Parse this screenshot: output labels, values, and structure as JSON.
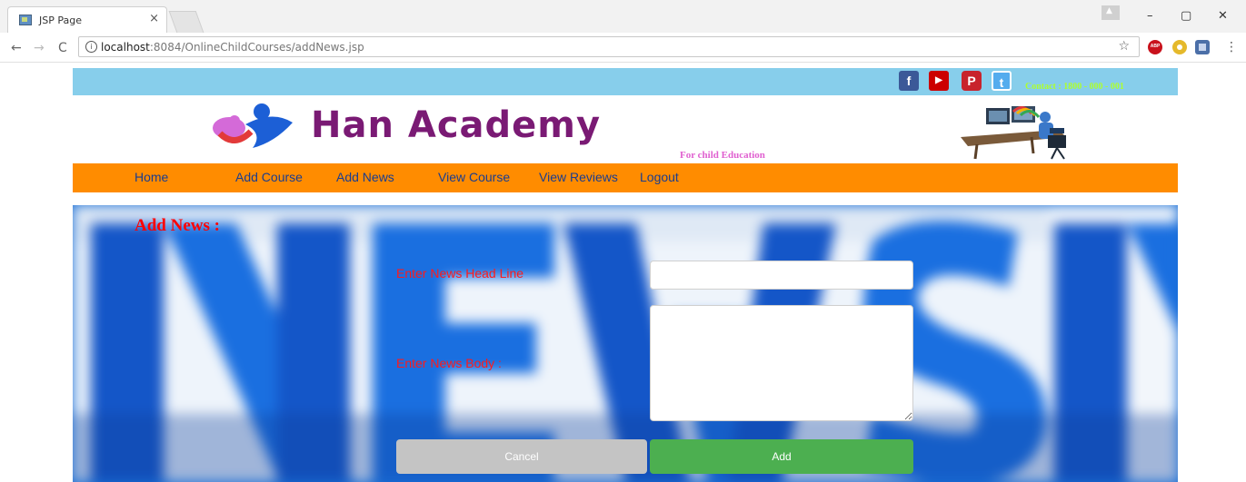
{
  "browser": {
    "tab_title": "JSP Page",
    "tab_close": "×",
    "url_host": "localhost",
    "url_path": ":8084/OnlineChildCourses/addNews.jsp",
    "nav_back": "←",
    "nav_forward": "→",
    "nav_reload": "C",
    "info": "i",
    "bookmark": "☆",
    "window_controls": {
      "minimize": "–",
      "restore": "▢",
      "close": "✕"
    },
    "menu": "⋮"
  },
  "topbar": {
    "social": [
      {
        "name": "facebook-icon",
        "glyph": "f"
      },
      {
        "name": "youtube-icon",
        "glyph": "▶"
      },
      {
        "name": "pinterest-icon",
        "glyph": "P"
      },
      {
        "name": "twitter-icon",
        "glyph": "t"
      }
    ],
    "contact": "Contact : 1800 - 000 - 001"
  },
  "header": {
    "brand": "Han Academy",
    "tagline": "For child Education"
  },
  "nav": {
    "items": [
      "Home",
      "Add Course",
      "Add News",
      "View Course",
      "View Reviews",
      "Logout"
    ]
  },
  "main": {
    "title": "Add News :",
    "headline_label": "Enter News Head Line",
    "headline_value": "",
    "body_label": "Enter News Body :",
    "body_value": "",
    "cancel_label": "Cancel",
    "add_label": "Add"
  },
  "colors": {
    "topbar": "#87ceeb",
    "navbar": "#ff8c00",
    "nav_text": "#1a3d8f",
    "label_red": "#ff1a1a",
    "add_green": "#4caf50",
    "cancel_gray": "#c4c4c4"
  }
}
